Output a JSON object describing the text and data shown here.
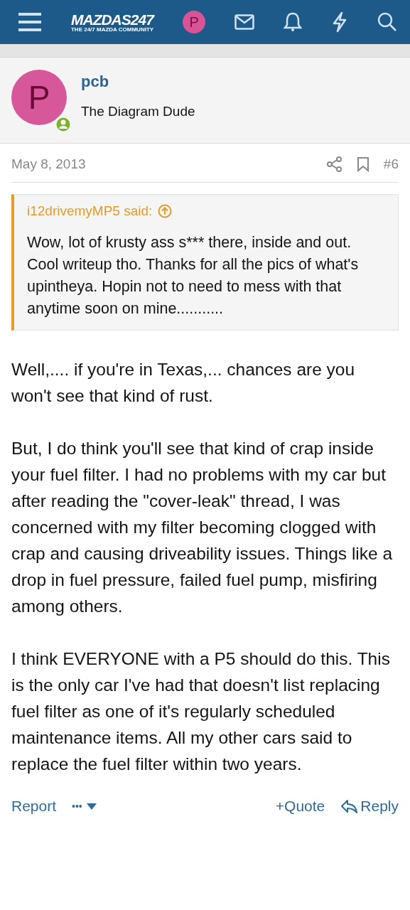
{
  "header": {
    "logo": {
      "name": "MAZDAS247",
      "tagline": "THE 24/7 MAZDA COMMUNITY"
    },
    "avatar_letter": "P"
  },
  "post": {
    "author": {
      "name": "pcb",
      "title": "The Diagram Dude",
      "avatar_letter": "P",
      "online": true
    },
    "date": "May 8, 2013",
    "number": "#6",
    "quote": {
      "author": "i12drivemyMP5 said:",
      "text": "Wow, lot of krusty ass s*** there, inside and out. Cool writeup tho. Thanks for all the pics of what's upintheya. Hopin not to need to mess with that anytime soon on mine..........."
    },
    "paragraphs": [
      "Well,.... if you're in Texas,... chances are you won't see that kind of rust.",
      "But, I do think you'll see that kind of crap inside your fuel filter. I had no problems with my car but after reading the \"cover-leak\" thread, I was concerned with my filter becoming clogged with crap and causing driveability issues. Things like a drop in fuel pressure, failed fuel pump, misfiring among others.",
      "I think EVERYONE with a P5 should do this. This is the only car I've had that doesn't list replacing fuel filter as one of it's regularly scheduled maintenance items. All my other cars said to replace the fuel filter within two years."
    ],
    "actions": {
      "report": "Report",
      "more": "•••",
      "quote": "Quote",
      "quote_prefix": "+",
      "reply": "Reply"
    }
  }
}
